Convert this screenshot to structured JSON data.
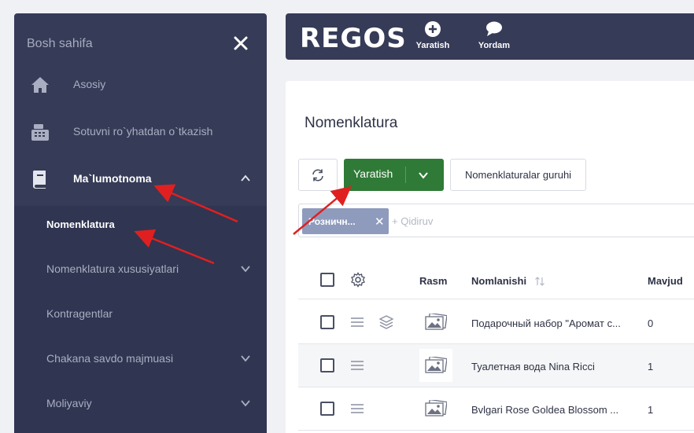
{
  "sidebar": {
    "header": "Bosh sahifa",
    "items": [
      {
        "label": "Asosiy"
      },
      {
        "label": "Sotuvni ro`yhatdan o`tkazish"
      },
      {
        "label": "Ma`lumotnoma"
      }
    ],
    "subitems": [
      {
        "label": "Nomenklatura"
      },
      {
        "label": "Nomenklatura xususiyatlari"
      },
      {
        "label": "Kontragentlar"
      },
      {
        "label": "Chakana savdo majmuasi"
      },
      {
        "label": "Moliyaviy"
      }
    ]
  },
  "topbar": {
    "logo": "REGOS",
    "create_label": "Yaratish",
    "help_label": "Yordam"
  },
  "page": {
    "title": "Nomenklatura",
    "create_label": "Yaratish",
    "groups_label": "Nomenklaturalar guruhi",
    "filter_chip": "Розничн...",
    "search_placeholder": "+ Qidiruv"
  },
  "table": {
    "columns": {
      "image": "Rasm",
      "name": "Nomlanishi",
      "stock": "Mavjud"
    },
    "rows": [
      {
        "name": "Подарочный набор \"Аромат с...",
        "qty": "0"
      },
      {
        "name": "Туалетная вода Nina Ricci",
        "qty": "1"
      },
      {
        "name": "Bvlgari Rose Goldea Blossom ...",
        "qty": "1"
      }
    ]
  },
  "colors": {
    "sidebar": "#363b57",
    "primary": "#2f7a37",
    "chip": "#8e9bbd",
    "annotation": "#e02020"
  }
}
